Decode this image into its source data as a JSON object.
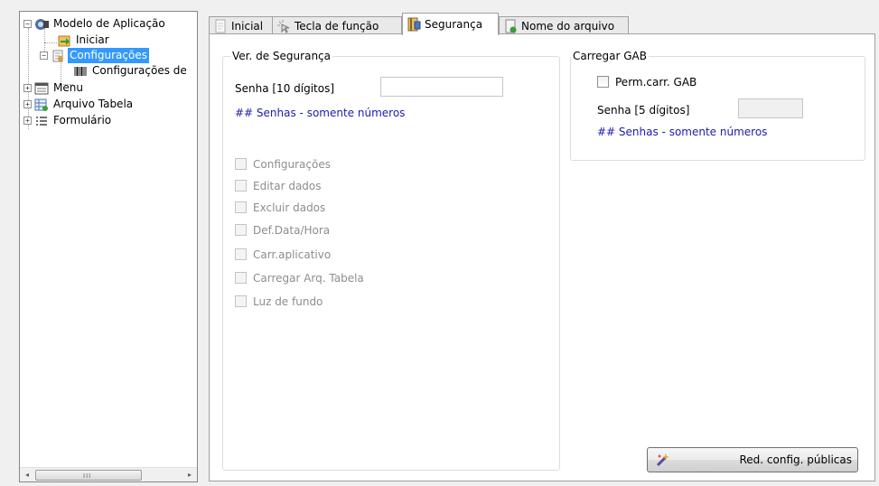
{
  "tree": {
    "root": "Modelo de Aplicação",
    "iniciar": "Iniciar",
    "configuracoes": "Configurações",
    "configuracoes_de": "Configurações de",
    "menu": "Menu",
    "arquivo_tabela": "Arquivo Tabela",
    "formulario": "Formulário"
  },
  "scroll": {
    "left_arrow": "◂",
    "right_arrow": "▸",
    "grip": "III"
  },
  "tabs": [
    "Inicial",
    "Tecla de função",
    "Segurança",
    "Nome do arquivo"
  ],
  "ver_seguranca": {
    "title": "Ver. de Segurança",
    "password_label": "Senha [10 dígitos]",
    "password_value": "",
    "note": "## Senhas - somente números",
    "checkboxes": [
      "Configurações",
      "Editar dados",
      "Excluir dados",
      "Def.Data/Hora",
      "Carr.aplicativo",
      "Carregar Arq. Tabela",
      "Luz de fundo"
    ]
  },
  "carregar_gab": {
    "title": "Carregar GAB",
    "perm_label": "Perm.carr. GAB",
    "password_label": "Senha [5 dígitos]",
    "password_value": "",
    "note": "## Senhas - somente números"
  },
  "button": {
    "label": "Red. config. públicas"
  },
  "colors": {
    "selection": "#3399ff",
    "note_text": "#1c1cb0",
    "disabled_text": "#8d8d8d"
  }
}
